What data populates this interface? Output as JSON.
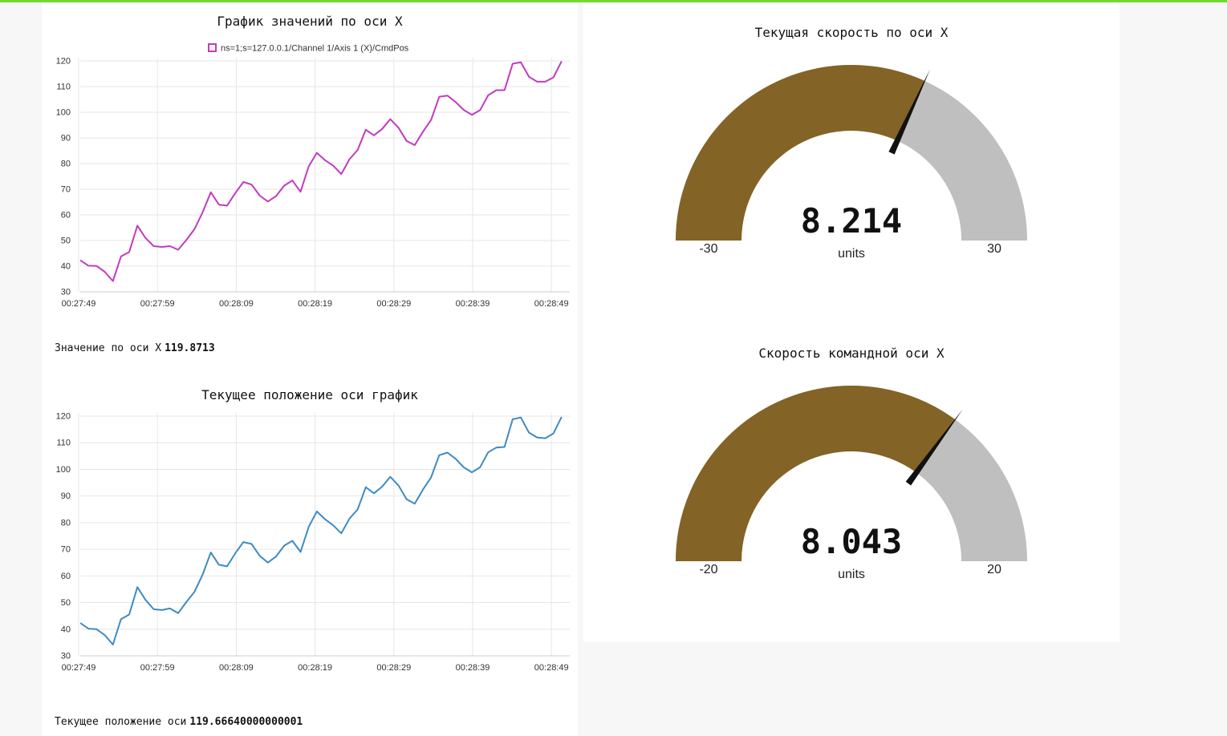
{
  "colors": {
    "accent_bar": "#6edb2d",
    "series1": "#c23bbf",
    "series2": "#3d8bc4",
    "gauge_fill": "#836326",
    "gauge_bg": "#bfbfbf",
    "needle": "#111111"
  },
  "chart1": {
    "title": "График значений по оси X",
    "legend": "ns=1;s=127.0.0.1/Channel 1/Axis 1 (X)/CmdPos",
    "value_label": "Значение по оси X",
    "value": "119.8713"
  },
  "chart2": {
    "title": "Текущее положение оси график",
    "value_label": "Текущее положение оси",
    "value": "119.66640000000001"
  },
  "gauge1": {
    "title": "Текущая скорость по оси X",
    "value": "8.214",
    "units": "units",
    "min": "-30",
    "max": "30"
  },
  "gauge2": {
    "title": "Скорость командной оси X",
    "value": "8.043",
    "units": "units",
    "min": "-20",
    "max": "20"
  },
  "chart_data": [
    {
      "type": "line",
      "title": "График значений по оси X",
      "x_ticks": [
        "00:27:49",
        "00:27:59",
        "00:28:09",
        "00:28:19",
        "00:28:29",
        "00:28:39",
        "00:28:49"
      ],
      "y_ticks": [
        "30",
        "40",
        "50",
        "60",
        "70",
        "80",
        "90",
        "100",
        "110",
        "120"
      ],
      "ylim": [
        30,
        120
      ],
      "xlim_seconds": [
        0,
        60
      ],
      "grid": true,
      "legend_position": "top-center",
      "series": [
        {
          "name": "ns=1;s=127.0.0.1/Channel 1/Axis 1 (X)/CmdPos",
          "x": [
            0,
            1,
            2,
            3,
            4,
            5,
            6,
            7,
            8,
            9,
            10,
            11,
            12,
            13,
            14,
            15,
            16,
            17,
            18,
            19,
            20,
            21,
            22,
            23,
            24,
            25,
            26,
            27,
            28,
            29,
            30,
            31,
            32,
            33,
            34,
            35,
            36,
            37,
            38,
            39,
            40,
            41,
            42,
            43,
            44,
            45,
            46,
            47,
            48,
            49,
            50,
            51,
            52,
            53,
            54,
            55,
            56,
            57,
            58,
            59
          ],
          "y": [
            42.3,
            40.2,
            40.1,
            37.8,
            34.2,
            43.8,
            45.5,
            55.8,
            51.0,
            47.8,
            47.5,
            47.8,
            46.4,
            50.2,
            54.4,
            61.0,
            68.8,
            64.0,
            63.6,
            68.5,
            72.8,
            71.8,
            67.5,
            65.2,
            67.3,
            71.4,
            73.4,
            69.0,
            78.9,
            84.2,
            81.3,
            79.2,
            75.9,
            81.7,
            85.3,
            93.2,
            91.0,
            93.5,
            97.3,
            94.0,
            88.8,
            87.2,
            92.4,
            97.0,
            106.0,
            106.5,
            104.0,
            100.9,
            99.0,
            100.8,
            106.6,
            108.6,
            108.6,
            118.9,
            119.5,
            113.8,
            111.9,
            111.9,
            113.6,
            119.87
          ]
        }
      ]
    },
    {
      "type": "line",
      "title": "Текущее положение оси график",
      "x_ticks": [
        "00:27:49",
        "00:27:59",
        "00:28:09",
        "00:28:19",
        "00:28:29",
        "00:28:39",
        "00:28:49"
      ],
      "y_ticks": [
        "30",
        "40",
        "50",
        "60",
        "70",
        "80",
        "90",
        "100",
        "110",
        "120"
      ],
      "ylim": [
        30,
        120
      ],
      "xlim_seconds": [
        0,
        60
      ],
      "grid": true,
      "series": [
        {
          "x": [
            0,
            1,
            2,
            3,
            4,
            5,
            6,
            7,
            8,
            9,
            10,
            11,
            12,
            13,
            14,
            15,
            16,
            17,
            18,
            19,
            20,
            21,
            22,
            23,
            24,
            25,
            26,
            27,
            28,
            29,
            30,
            31,
            32,
            33,
            34,
            35,
            36,
            37,
            38,
            39,
            40,
            41,
            42,
            43,
            44,
            45,
            46,
            47,
            48,
            49,
            50,
            51,
            52,
            53,
            54,
            55,
            56,
            57,
            58,
            59
          ],
          "y": [
            42.3,
            40.2,
            40.0,
            37.8,
            34.2,
            43.8,
            45.5,
            55.8,
            51.0,
            47.5,
            47.2,
            47.8,
            46.0,
            50.2,
            54.0,
            60.5,
            68.8,
            64.2,
            63.6,
            68.5,
            72.7,
            72.0,
            67.5,
            65.0,
            67.3,
            71.4,
            73.2,
            69.0,
            78.4,
            84.2,
            81.3,
            79.0,
            76.0,
            81.5,
            85.0,
            93.3,
            91.0,
            93.5,
            97.2,
            94.0,
            88.8,
            87.1,
            92.4,
            97.0,
            105.3,
            106.3,
            104.0,
            100.8,
            98.9,
            100.8,
            106.4,
            108.2,
            108.4,
            118.8,
            119.5,
            113.8,
            112.0,
            111.7,
            113.5,
            119.67
          ]
        }
      ]
    }
  ],
  "gauges_data": [
    {
      "value": 8.214,
      "min": -30,
      "max": 30
    },
    {
      "value": 8.043,
      "min": -20,
      "max": 20
    }
  ]
}
